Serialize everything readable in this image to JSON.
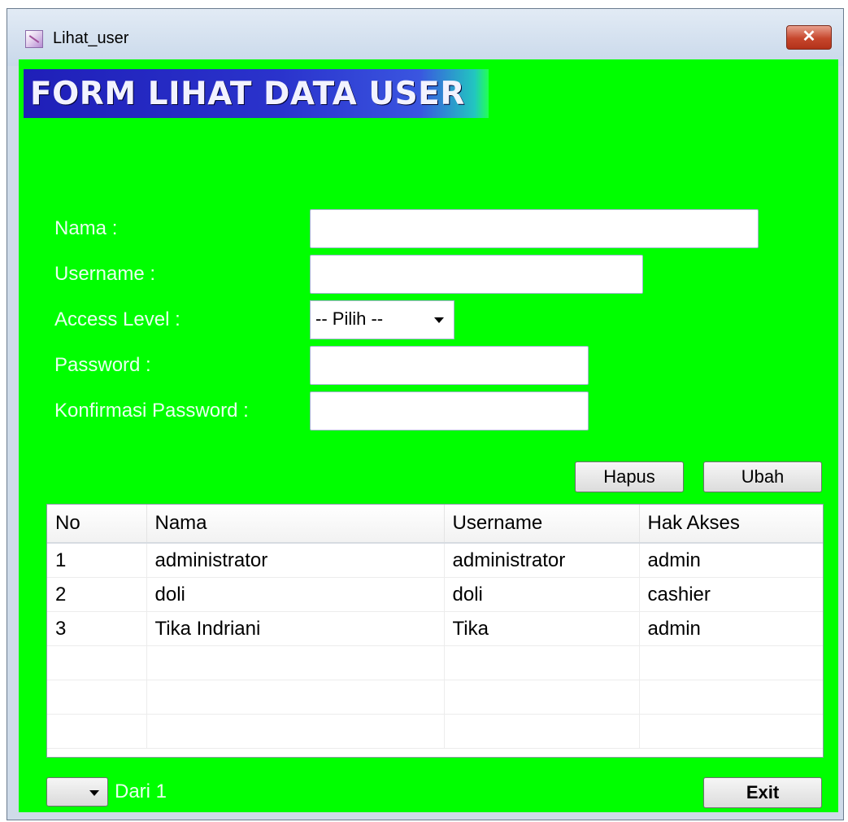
{
  "window": {
    "title": "Lihat_user",
    "close_glyph": "✕",
    "icon": "app-form-icon"
  },
  "form": {
    "header": "FORM LIHAT DATA USER",
    "fields": {
      "nama_label": "Nama :",
      "nama_value": "",
      "username_label": "Username :",
      "username_value": "",
      "access_level_label": "Access Level :",
      "access_level_value": "-- Pilih --",
      "password_label": "Password :",
      "password_value": "",
      "konfirmasi_label": "Konfirmasi Password :",
      "konfirmasi_value": ""
    },
    "buttons": {
      "hapus": "Hapus",
      "ubah": "Ubah",
      "exit": "Exit"
    }
  },
  "table": {
    "columns": [
      "No",
      "Nama",
      "Username",
      "Hak Akses"
    ],
    "rows": [
      [
        "1",
        "administrator",
        "administrator",
        "admin"
      ],
      [
        "2",
        "doli",
        "doli",
        "cashier"
      ],
      [
        "3",
        "Tika Indriani",
        "Tika",
        "admin"
      ],
      [
        "",
        "",
        "",
        ""
      ],
      [
        "",
        "",
        "",
        ""
      ],
      [
        "",
        "",
        "",
        ""
      ]
    ]
  },
  "pager": {
    "page_value": "",
    "of_label": "Dari 1"
  },
  "colors": {
    "background": "#00ff00",
    "header_gradient_start": "#1f1fb8",
    "header_text": "#f2f2ff"
  }
}
